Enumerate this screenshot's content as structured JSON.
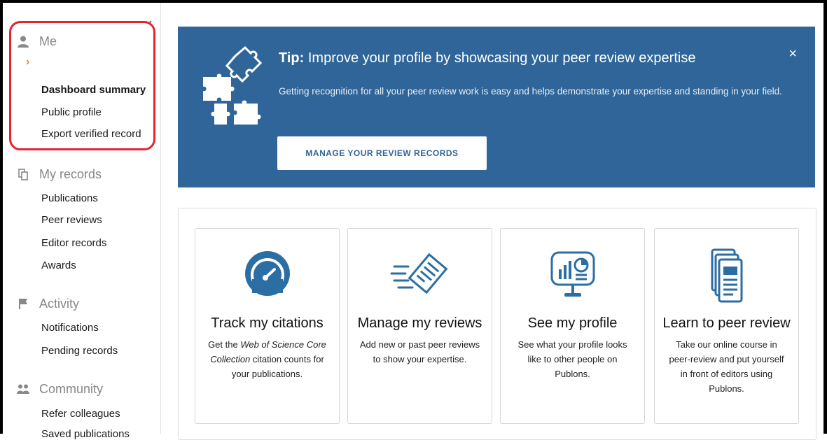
{
  "sidebar": {
    "sections": [
      {
        "title": "Me",
        "items": [
          "Dashboard summary",
          "Public profile",
          "Export verified record"
        ]
      },
      {
        "title": "My records",
        "items": [
          "Publications",
          "Peer reviews",
          "Editor records",
          "Awards"
        ]
      },
      {
        "title": "Activity",
        "items": [
          "Notifications",
          "Pending records"
        ]
      },
      {
        "title": "Community",
        "items": [
          "Refer colleagues",
          "Saved publications"
        ]
      }
    ]
  },
  "tip": {
    "prefix": "Tip:",
    "title": " Improve your profile by showcasing your peer review expertise",
    "body": "Getting recognition for all your peer review work is easy and helps demonstrate your expertise and standing in your field.",
    "button": "MANAGE YOUR REVIEW RECORDS",
    "close": "×"
  },
  "cards": [
    {
      "title": "Track my citations",
      "desc_pre": "Get the ",
      "desc_em": "Web of Science Core Collection",
      "desc_post": " citation counts for your publications.",
      "icon": "speedometer-icon"
    },
    {
      "title": "Manage my reviews",
      "desc": "Add new or past peer reviews to show your expertise.",
      "icon": "document-speed-icon"
    },
    {
      "title": "See my profile",
      "desc": "See what your profile looks like to other people on Publons.",
      "icon": "monitor-chart-icon"
    },
    {
      "title": "Learn to peer review",
      "desc": "Take our online course in peer-review and put yourself in front of editors using Publons.",
      "icon": "documents-stack-icon"
    }
  ],
  "colors": {
    "banner": "#2f6598",
    "accent": "#f08a1c",
    "highlight": "#e6232f"
  }
}
